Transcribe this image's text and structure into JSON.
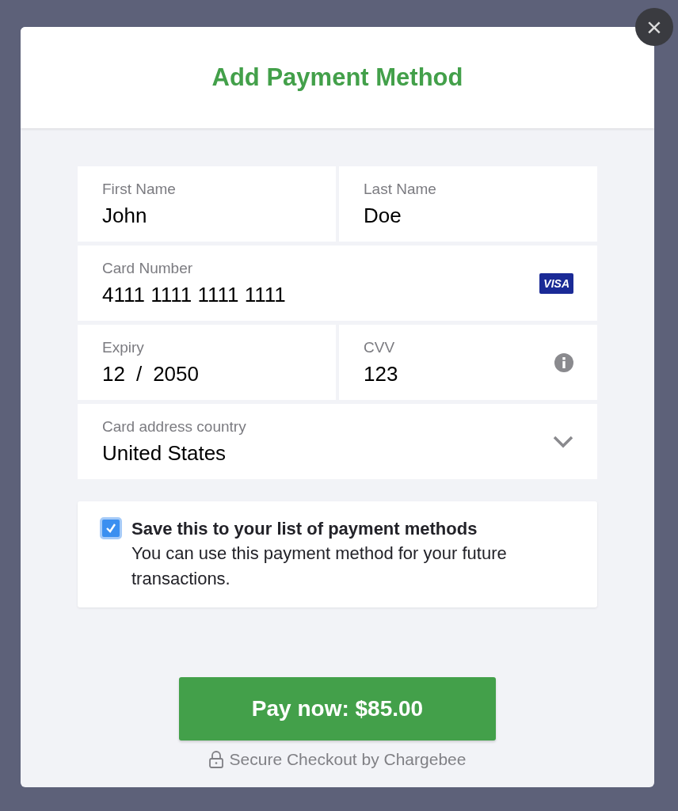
{
  "dialog": {
    "title": "Add Payment Method",
    "close_label": "×"
  },
  "form_rows": [
    [
      {
        "kind": "text",
        "label": "First Name",
        "value": "John"
      },
      {
        "kind": "text",
        "label": "Last Name",
        "value": "Doe"
      }
    ],
    [
      {
        "kind": "card",
        "label": "Card Number",
        "value": "4111 1111 1111 1111",
        "brand": "VISA"
      }
    ],
    [
      {
        "kind": "expiry",
        "label": "Expiry",
        "month": "12",
        "separator": "/",
        "year": "2050"
      },
      {
        "kind": "cvv",
        "label": "CVV",
        "value": "123"
      }
    ],
    [
      {
        "kind": "select",
        "label": "Card address country",
        "value": "United States"
      }
    ]
  ],
  "save_option": {
    "checked": true,
    "title": "Save this to your list of payment methods",
    "description": "You can use this payment method for your future transactions."
  },
  "pay_button": "Pay now: $85.00",
  "footer": "Secure Checkout by Chargebee"
}
